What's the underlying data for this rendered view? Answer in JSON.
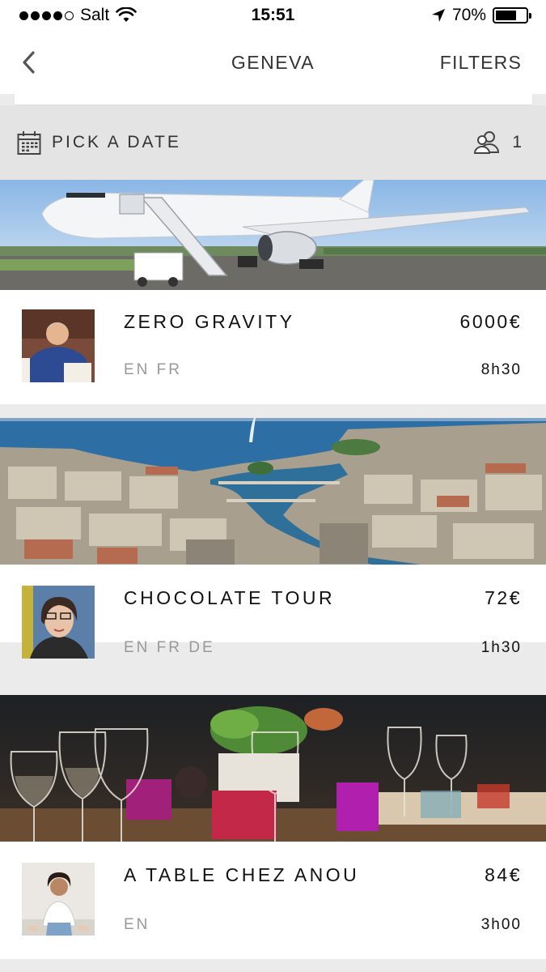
{
  "status": {
    "carrier": "Salt",
    "time": "15:51",
    "battery_text": "70%",
    "battery_level": 0.7
  },
  "nav": {
    "title": "GENEVA",
    "filters": "FILTERS"
  },
  "datebar": {
    "label": "PICK A DATE",
    "guests": "1"
  },
  "experiences": [
    {
      "title": "ZERO GRAVITY",
      "price": "6000€",
      "languages": "EN FR",
      "duration": "8h30"
    },
    {
      "title": "CHOCOLATE TOUR",
      "price": "72€",
      "languages": "EN FR DE",
      "duration": "1h30"
    },
    {
      "title": "A TABLE CHEZ ANOU",
      "price": "84€",
      "languages": "EN",
      "duration": "3h00"
    }
  ]
}
